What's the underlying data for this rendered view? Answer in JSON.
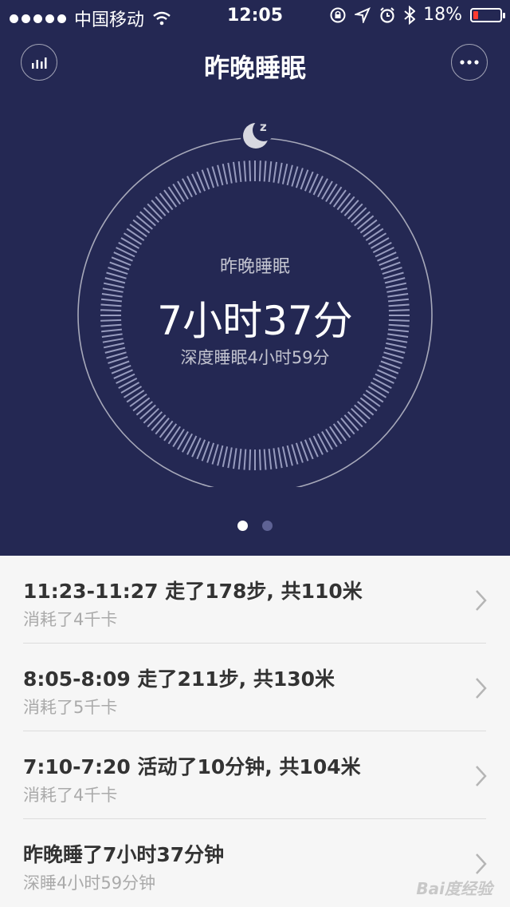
{
  "status_bar": {
    "carrier": "中国移动",
    "time": "12:05",
    "battery": "18%",
    "battery_level": 0.18
  },
  "header": {
    "title": "昨晚睡眠",
    "left_icon": "bar-chart-icon",
    "right_icon": "more-icon"
  },
  "dial": {
    "icon": "moon-sleep-icon",
    "label": "昨晚睡眠",
    "value": "7小时37分",
    "sub": "深度睡眠4小时59分"
  },
  "pager": {
    "pages": 2,
    "active": 0
  },
  "activities": [
    {
      "title": "11:23-11:27 走了178步, 共110米",
      "subtitle": "消耗了4千卡"
    },
    {
      "title": "8:05-8:09 走了211步, 共130米",
      "subtitle": "消耗了5千卡"
    },
    {
      "title": "7:10-7:20 活动了10分钟, 共104米",
      "subtitle": "消耗了4千卡"
    },
    {
      "title": "昨晚睡了7小时37分钟",
      "subtitle": "深睡4小时59分钟"
    }
  ],
  "watermark": "Bai度经验",
  "colors": {
    "background_top": "#242853",
    "list_bg": "#f6f6f6",
    "battery_low": "#ff3b30"
  }
}
